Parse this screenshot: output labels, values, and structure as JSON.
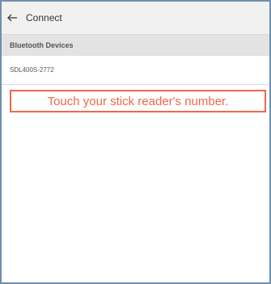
{
  "app_bar": {
    "back_icon": "arrow-left-icon",
    "title": "Connect"
  },
  "section": {
    "header": "Bluetooth Devices"
  },
  "devices": [
    {
      "name": "SDL400S-2772"
    }
  ],
  "callout": {
    "text": "Touch your stick reader's number.",
    "color": "#f0674a"
  },
  "colors": {
    "frame_border": "#6f8fae",
    "app_bar_bg": "#f1f1f1",
    "section_header_bg": "#e3e3e3"
  }
}
